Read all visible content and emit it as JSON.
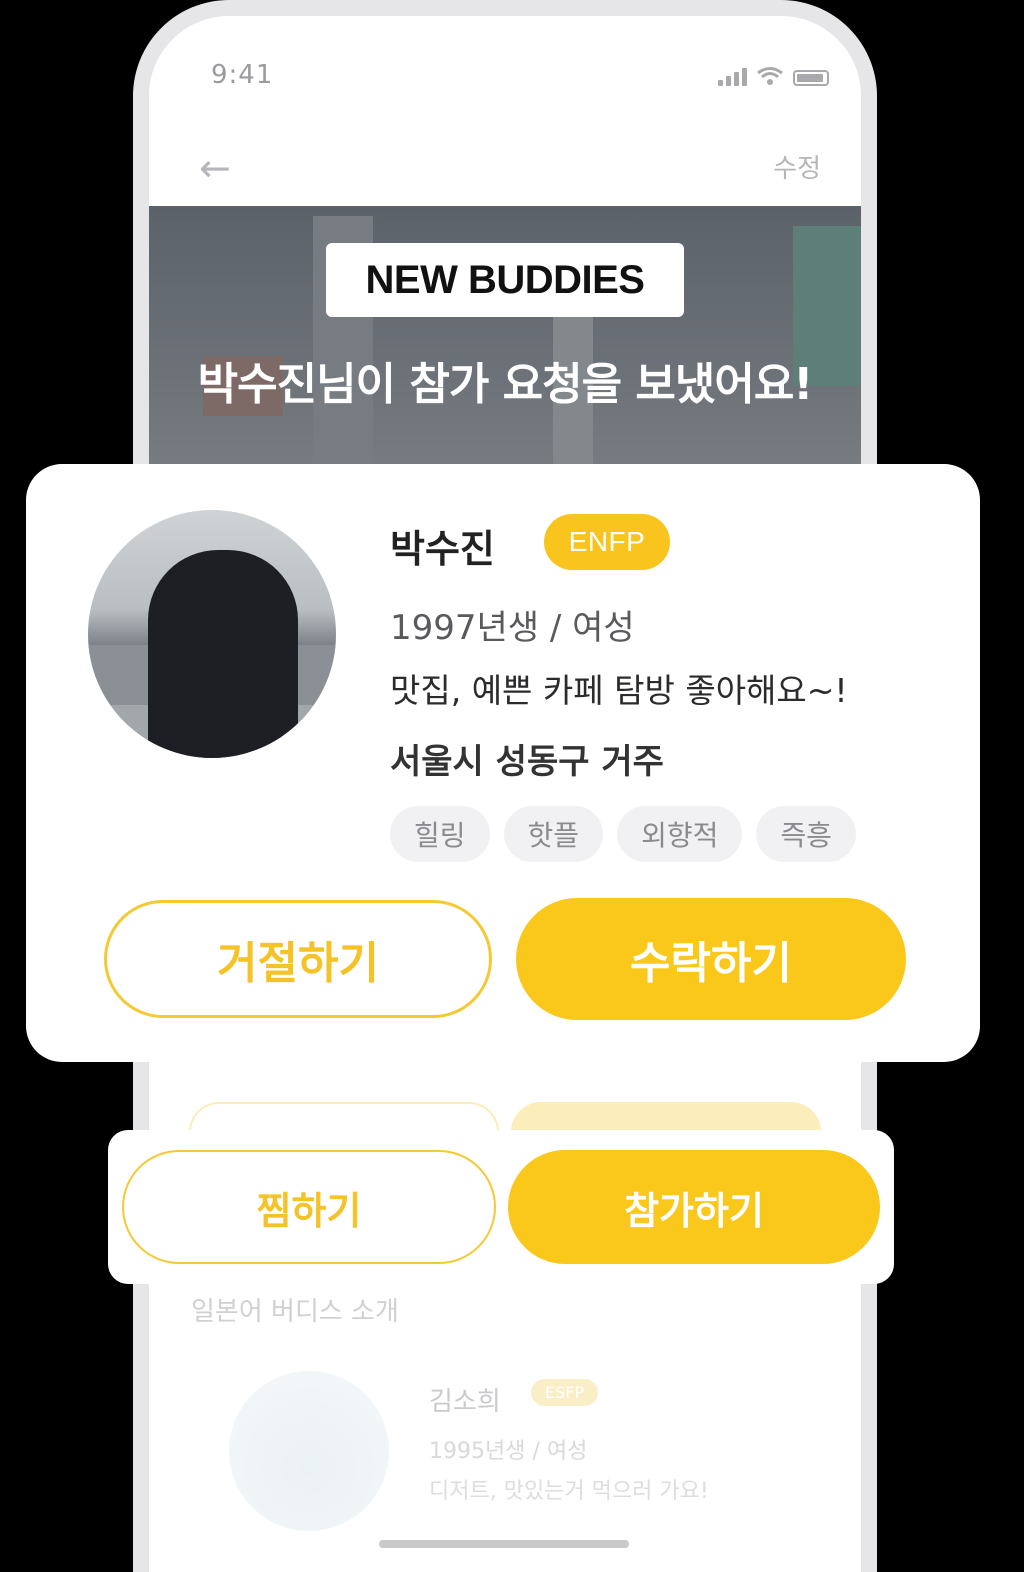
{
  "status_bar": {
    "time": "9:41",
    "icons": [
      "signal-icon",
      "wifi-icon",
      "battery-icon"
    ]
  },
  "nav": {
    "back_icon": "←",
    "edit_label": "수정"
  },
  "overlay": {
    "badge": "NEW BUDDIES",
    "headline": "박수진님이 참가 요청을 보냈어요!"
  },
  "request_card": {
    "name": "박수진",
    "mbti": "ENFP",
    "birth_gender": "1997년생 / 여성",
    "intro": "맛집, 예쁜 카페 탐방 좋아해요~!",
    "location": "서울시 성동구 거주",
    "tags": [
      "힐링",
      "핫플",
      "외향적",
      "즉흥"
    ],
    "reject_label": "거절하기",
    "accept_label": "수락하기"
  },
  "action_bar": {
    "wish_label": "찜하기",
    "join_label": "참가하기"
  },
  "background_profile": {
    "section_title": "일본어 버디스 소개",
    "name": "김소희",
    "mbti": "ESFP",
    "birth_gender": "1995년생 / 여성",
    "intro": "디저트, 맛있는거 먹으러 가요!"
  },
  "colors": {
    "accent": "#f9c81b",
    "background": "#000000",
    "card": "#ffffff"
  }
}
